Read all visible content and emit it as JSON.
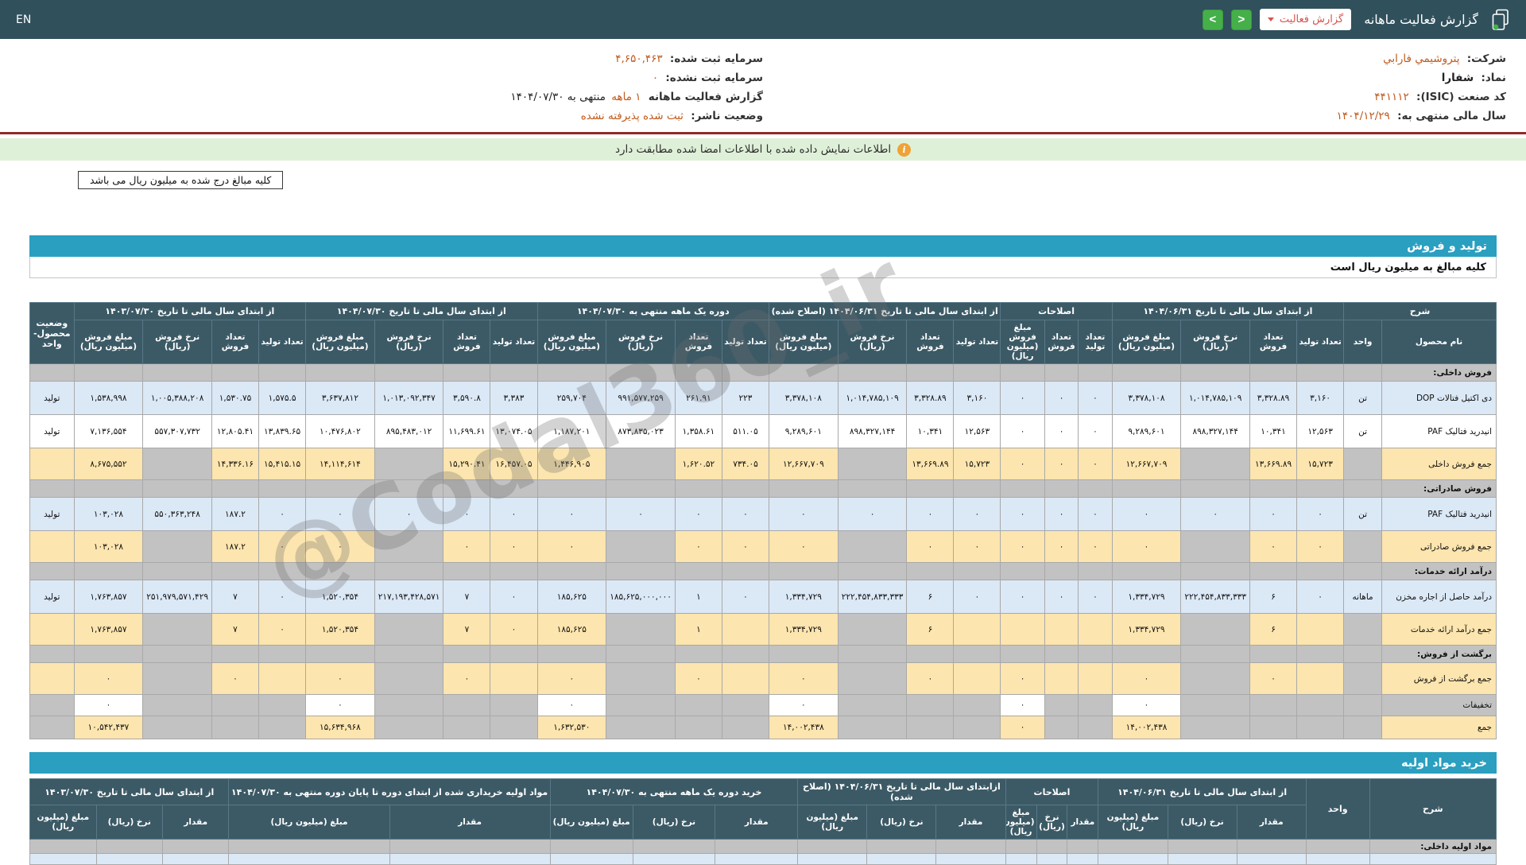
{
  "colors": {
    "topbar_bg": "#30505c",
    "table_header_bg": "#3c5a66",
    "accent_value": "#bf5a1d",
    "notice_bg": "#dff0d8",
    "section_bar_bg": "#2a9fc0",
    "total_row_bg": "#fce5ae",
    "zebra_blue_row_bg": "#dbe8f6",
    "section_row_bg": "#c2c2c2",
    "red_rule": "#8f2b26",
    "nav_green": "#45b049",
    "report_btn_red": "#d9534f",
    "notice_icon": "#f0a235"
  },
  "topbar": {
    "en_label": "EN",
    "title": "گزارش فعالیت ماهانه",
    "report_button": "گزارش فعالیت",
    "nav_back": "<",
    "nav_forward": ">"
  },
  "info": {
    "right": [
      {
        "label": "شرکت:",
        "value": "پتروشيمي فارابي"
      },
      {
        "label": "نماد:",
        "value": "شفارا",
        "dark": true
      },
      {
        "label": "کد صنعت (ISIC):",
        "value": "۴۴۱۱۱۲"
      },
      {
        "label": "سال مالی منتهی به:",
        "value": "۱۴۰۴/۱۲/۲۹"
      }
    ],
    "left": [
      {
        "label": "سرمایه ثبت شده:",
        "value": "۴,۶۵۰,۴۶۳"
      },
      {
        "label": "سرمایه ثبت نشده:",
        "value": "۰"
      },
      {
        "label": "گزارش فعالیت ماهانه",
        "value": "۱ ماهه",
        "suffix": "منتهی به ۱۴۰۴/۰۷/۳۰"
      },
      {
        "label": "وضعیت ناشر:",
        "value": "ثبت شده پذیرفته نشده"
      }
    ]
  },
  "notice": {
    "text": "اطلاعات نمایش داده شده با اطلاعات امضا شده مطابقت دارد"
  },
  "boxes": {
    "amounts_note": "کلیه مبالغ درج شده به میلیون ریال می باشد"
  },
  "sections": {
    "production_sales": {
      "title": "تولید و فروش",
      "subtitle": "کلیه مبالغ به میلیون ریال است"
    },
    "raw_materials": {
      "title": "خرید مواد اولیه"
    }
  },
  "watermark": {
    "text": "@Codal360_ir"
  },
  "table1": {
    "groups": [
      {
        "label": "شرح",
        "span": 2
      },
      {
        "label": "از ابتدای سال مالی تا تاریخ ۱۴۰۴/۰۶/۳۱",
        "span": 4
      },
      {
        "label": "اصلاحات",
        "span": 3
      },
      {
        "label": "از ابتدای سال مالی تا تاریخ ۱۴۰۴/۰۶/۳۱ (اصلاح شده)",
        "span": 4
      },
      {
        "label": "دوره یک ماهه منتهی به ۱۴۰۴/۰۷/۳۰",
        "span": 4
      },
      {
        "label": "از ابتدای سال مالی تا تاریخ ۱۴۰۴/۰۷/۳۰",
        "span": 4
      },
      {
        "label": "از ابتدای سال مالی تا تاریخ ۱۴۰۳/۰۷/۳۰",
        "span": 4
      },
      {
        "label": "وضعیت محصول- واحد",
        "span": 1,
        "rowspan": true
      }
    ],
    "subheaders": [
      "نام محصول",
      "واحد",
      "تعداد تولید",
      "تعداد فروش",
      "نرخ فروش (ریال)",
      "مبلغ فروش (میلیون ریال)",
      "تعداد تولید",
      "تعداد فروش",
      "مبلغ فروش (میلیون ریال)",
      "تعداد تولید",
      "تعداد فروش",
      "نرخ فروش (ریال)",
      "مبلغ فروش (میلیون ریال)",
      "تعداد تولید",
      "تعداد فروش",
      "نرخ فروش (ریال)",
      "مبلغ فروش (میلیون ریال)",
      "تعداد تولید",
      "تعداد فروش",
      "نرخ فروش (ریال)",
      "مبلغ فروش (میلیون ریال)",
      "تعداد تولید",
      "تعداد فروش",
      "نرخ فروش (ریال)",
      "مبلغ فروش (میلیون ریال)"
    ],
    "widths": [
      7.8,
      2.6,
      3.2,
      3.2,
      4.7,
      4.7,
      2.3,
      2.3,
      3.0,
      3.2,
      3.2,
      4.7,
      4.7,
      3.2,
      3.2,
      4.7,
      4.7,
      3.2,
      3.2,
      4.7,
      4.7,
      3.2,
      3.2,
      4.7,
      4.7,
      3.0
    ],
    "kinds": [
      "name",
      "unit",
      "qty",
      "qty",
      "rate",
      "amount",
      "qty",
      "qty",
      "amount",
      "qty",
      "qty",
      "rate",
      "amount",
      "qty",
      "qty",
      "rate",
      "amount",
      "qty",
      "qty",
      "rate",
      "amount",
      "qty",
      "qty",
      "rate",
      "amount",
      "status"
    ],
    "rows": [
      {
        "type": "section",
        "label": "فروش داخلی:"
      },
      {
        "type": "data",
        "zebra": "blue",
        "cells": [
          "دی اکتیل فتالات DOP",
          "تن",
          "۳,۱۶۰",
          "۳,۳۲۸.۸۹",
          "۱,۰۱۴,۷۸۵,۱۰۹",
          "۳,۳۷۸,۱۰۸",
          "۰",
          "۰",
          "۰",
          "۳,۱۶۰",
          "۳,۳۲۸.۸۹",
          "۱,۰۱۴,۷۸۵,۱۰۹",
          "۳,۳۷۸,۱۰۸",
          "۲۲۳",
          "۲۶۱.۹۱",
          "۹۹۱,۵۷۷,۲۵۹",
          "۲۵۹,۷۰۴",
          "۳,۳۸۳",
          "۳,۵۹۰.۸",
          "۱,۰۱۳,۰۹۲,۳۴۷",
          "۳,۶۳۷,۸۱۲",
          "۱,۵۷۵.۵",
          "۱,۵۳۰.۷۵",
          "۱,۰۰۵,۳۸۸,۲۰۸",
          "۱,۵۳۸,۹۹۸",
          "تولید"
        ]
      },
      {
        "type": "data",
        "zebra": "white",
        "cells": [
          "انیدرید فتالیک PAF",
          "تن",
          "۱۲,۵۶۳",
          "۱۰,۳۴۱",
          "۸۹۸,۳۲۷,۱۴۴",
          "۹,۲۸۹,۶۰۱",
          "۰",
          "۰",
          "۰",
          "۱۲,۵۶۳",
          "۱۰,۳۴۱",
          "۸۹۸,۳۲۷,۱۴۴",
          "۹,۲۸۹,۶۰۱",
          "۵۱۱.۰۵",
          "۱,۳۵۸.۶۱",
          "۸۷۳,۸۳۵,۰۲۳",
          "۱,۱۸۷,۲۰۱",
          "۱۳,۰۷۴.۰۵",
          "۱۱,۶۹۹.۶۱",
          "۸۹۵,۴۸۳,۰۱۲",
          "۱۰,۴۷۶,۸۰۲",
          "۱۳,۸۳۹.۶۵",
          "۱۲,۸۰۵.۴۱",
          "۵۵۷,۳۰۷,۷۳۲",
          "۷,۱۳۶,۵۵۴",
          "تولید"
        ]
      },
      {
        "type": "total",
        "cells": [
          "جمع فروش داخلی",
          "",
          "۱۵,۷۲۳",
          "۱۳,۶۶۹.۸۹",
          "",
          "۱۲,۶۶۷,۷۰۹",
          "۰",
          "۰",
          "۰",
          "۱۵,۷۲۳",
          "۱۳,۶۶۹.۸۹",
          "",
          "۱۲,۶۶۷,۷۰۹",
          "۷۳۴.۰۵",
          "۱,۶۲۰.۵۲",
          "",
          "۱,۴۴۶,۹۰۵",
          "۱۶,۴۵۷.۰۵",
          "۱۵,۲۹۰.۴۱",
          "",
          "۱۴,۱۱۴,۶۱۴",
          "۱۵,۴۱۵.۱۵",
          "۱۴,۳۳۶.۱۶",
          "",
          "۸,۶۷۵,۵۵۲",
          ""
        ]
      },
      {
        "type": "section",
        "label": "فروش صادراتی:"
      },
      {
        "type": "data",
        "zebra": "blue",
        "cells": [
          "انیدرید فتالیک PAF",
          "تن",
          "۰",
          "۰",
          "۰",
          "۰",
          "۰",
          "۰",
          "۰",
          "۰",
          "۰",
          "۰",
          "۰",
          "۰",
          "۰",
          "۰",
          "۰",
          "۰",
          "۰",
          "۰",
          "۰",
          "۰",
          "۱۸۷.۲",
          "۵۵۰,۳۶۳,۲۴۸",
          "۱۰۳,۰۲۸",
          "تولید"
        ]
      },
      {
        "type": "total",
        "cells": [
          "جمع فروش صادراتی",
          "",
          "۰",
          "۰",
          "",
          "۰",
          "۰",
          "۰",
          "۰",
          "۰",
          "۰",
          "",
          "۰",
          "۰",
          "۰",
          "",
          "۰",
          "۰",
          "۰",
          "",
          "۰",
          "۰",
          "۱۸۷.۲",
          "",
          "۱۰۳,۰۲۸",
          ""
        ]
      },
      {
        "type": "section",
        "label": "درآمد ارائه خدمات:"
      },
      {
        "type": "data",
        "zebra": "blue",
        "cells": [
          "درآمد حاصل از اجاره مخزن",
          "ماهانه",
          "۰",
          "۶",
          "۲۲۲,۴۵۴,۸۳۳,۳۳۳",
          "۱,۳۳۴,۷۲۹",
          "۰",
          "۰",
          "۰",
          "۰",
          "۶",
          "۲۲۲,۴۵۴,۸۳۳,۳۳۳",
          "۱,۳۳۴,۷۲۹",
          "۰",
          "۱",
          "۱۸۵,۶۲۵,۰۰۰,۰۰۰",
          "۱۸۵,۶۲۵",
          "۰",
          "۷",
          "۲۱۷,۱۹۳,۴۲۸,۵۷۱",
          "۱,۵۲۰,۳۵۴",
          "۰",
          "۷",
          "۲۵۱,۹۷۹,۵۷۱,۴۲۹",
          "۱,۷۶۳,۸۵۷",
          "تولید"
        ]
      },
      {
        "type": "total",
        "cells": [
          "جمع درآمد ارائه خدمات",
          "",
          "",
          "۶",
          "",
          "۱,۳۳۴,۷۲۹",
          "",
          "",
          "",
          "",
          "۶",
          "",
          "۱,۳۳۴,۷۲۹",
          "",
          "۱",
          "",
          "۱۸۵,۶۲۵",
          "۰",
          "۷",
          "",
          "۱,۵۲۰,۳۵۴",
          "۰",
          "۷",
          "",
          "۱,۷۶۳,۸۵۷",
          ""
        ]
      },
      {
        "type": "section",
        "label": "برگشت از فروش:"
      },
      {
        "type": "total",
        "cells": [
          "جمع برگشت از فروش",
          "",
          "",
          "۰",
          "",
          "۰",
          "",
          "",
          "۰",
          "",
          "۰",
          "",
          "۰",
          "",
          "۰",
          "",
          "۰",
          "",
          "۰",
          "",
          "۰",
          "",
          "۰",
          "",
          "۰",
          ""
        ]
      },
      {
        "type": "discount",
        "cells": [
          "تخفیفات",
          "",
          "",
          "",
          "",
          "۰",
          "",
          "",
          "۰",
          "",
          "",
          "",
          "۰",
          "",
          "",
          "",
          "۰",
          "",
          "",
          "",
          "۰",
          "",
          "",
          "",
          "۰",
          ""
        ]
      },
      {
        "type": "grand",
        "cells": [
          "جمع",
          "",
          "",
          "",
          "",
          "۱۴,۰۰۲,۴۳۸",
          "",
          "",
          "۰",
          "",
          "",
          "",
          "۱۴,۰۰۲,۴۳۸",
          "",
          "",
          "",
          "۱,۶۳۲,۵۳۰",
          "",
          "",
          "",
          "۱۵,۶۳۴,۹۶۸",
          "",
          "",
          "",
          "۱۰,۵۴۲,۴۳۷",
          ""
        ]
      }
    ]
  },
  "table2": {
    "groups": [
      {
        "label": "شرح",
        "span": 1,
        "rowspan": true
      },
      {
        "label": "واحد",
        "span": 1,
        "rowspan": true
      },
      {
        "label": "از ابتدای سال مالی تا تاریخ ۱۴۰۴/۰۶/۳۱",
        "span": 3
      },
      {
        "label": "اصلاحات",
        "span": 3
      },
      {
        "label": "ازابتدای سال مالی تا تاریخ ۱۴۰۴/۰۶/۳۱ (اصلاح شده)",
        "span": 3
      },
      {
        "label": "خرید دوره یک ماهه منتهی به ۱۴۰۴/۰۷/۳۰",
        "span": 3
      },
      {
        "label": "مواد اولیه خریداری شده از ابتدای دوره تا پایان دوره منتهی به ۱۴۰۴/۰۷/۳۰",
        "span": 2
      },
      {
        "label": "از ابتدای سال مالی تا تاریخ ۱۴۰۳/۰۷/۳۰",
        "span": 3
      }
    ],
    "subheaders": [
      "مقدار",
      "نرخ (ریال)",
      "مبلغ (میلیون ریال)",
      "مقدار",
      "نرخ (ریال)",
      "مبلغ (میلیون ریال)",
      "مقدار",
      "نرخ (ریال)",
      "مبلغ (میلیون ریال)",
      "مقدار",
      "نرخ (ریال)",
      "مبلغ (میلیون ریال)",
      "مقدار",
      "مبلغ (میلیون ریال)",
      "مقدار",
      "نرخ (ریال)",
      "مبلغ (میلیون ریال)"
    ],
    "widths": [
      8.6,
      4.3,
      4.7,
      4.7,
      4.7,
      2.1,
      2.1,
      2.1,
      4.7,
      4.7,
      4.7,
      5.6,
      5.6,
      5.6,
      10.9,
      10.9,
      4.5,
      4.5,
      4.5
    ],
    "kinds": [
      "name",
      "unit",
      "qty",
      "rate",
      "amount",
      "qty",
      "rate",
      "amount",
      "qty",
      "rate",
      "amount",
      "qty",
      "rate",
      "amount",
      "qty",
      "amount",
      "qty",
      "rate",
      "amount"
    ],
    "rows": [
      {
        "type": "section",
        "label": "مواد اولیه داخلی:"
      },
      {
        "type": "data",
        "zebra": "blue",
        "cells": [
          "",
          "",
          "",
          "",
          "",
          "",
          "",
          "",
          "",
          "",
          "",
          "",
          "",
          "",
          "",
          "",
          "",
          "",
          ""
        ]
      }
    ]
  }
}
